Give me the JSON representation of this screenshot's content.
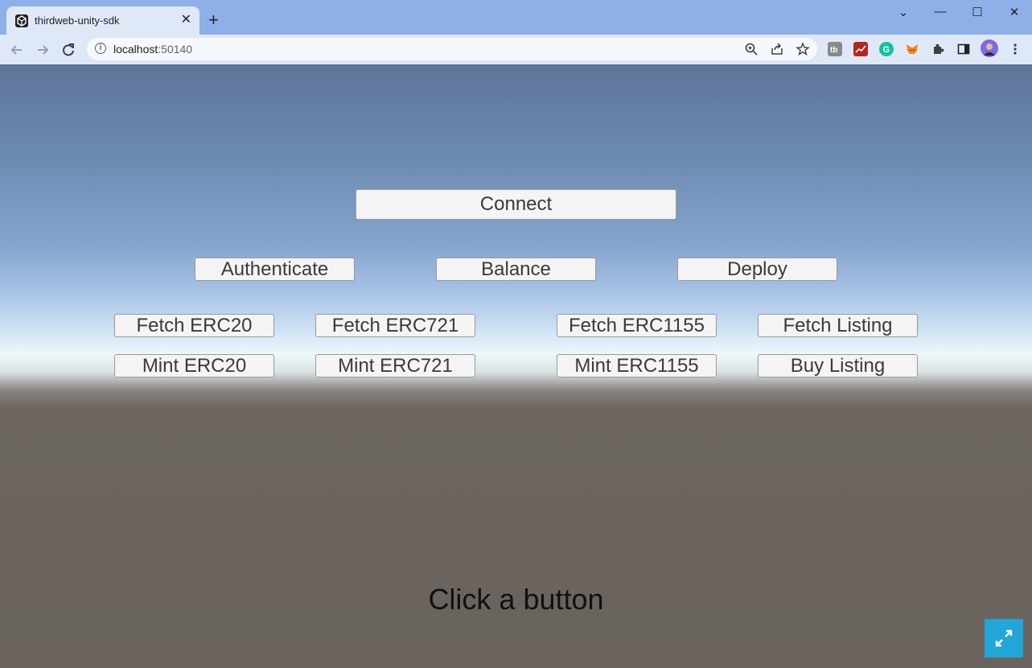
{
  "browser": {
    "tab_title": "thirdweb-unity-sdk",
    "tab_close": "✕",
    "new_tab": "+",
    "url_host": "localhost",
    "url_port": ":50140",
    "window_controls": [
      "⌄",
      "—",
      "☐",
      "✕"
    ]
  },
  "app": {
    "connect_label": "Connect",
    "row1": [
      "Authenticate",
      "Balance",
      "Deploy"
    ],
    "fetch_row": [
      "Fetch ERC20",
      "Fetch ERC721",
      "Fetch ERC1155",
      "Fetch Listing"
    ],
    "mint_row": [
      "Mint ERC20",
      "Mint ERC721",
      "Mint ERC1155",
      "Buy Listing"
    ],
    "status_text": "Click a button"
  },
  "colors": {
    "title_bar": "#8db0e8",
    "toolbar": "#dfe8f7",
    "fullscreen_button": "#21a6d7"
  }
}
